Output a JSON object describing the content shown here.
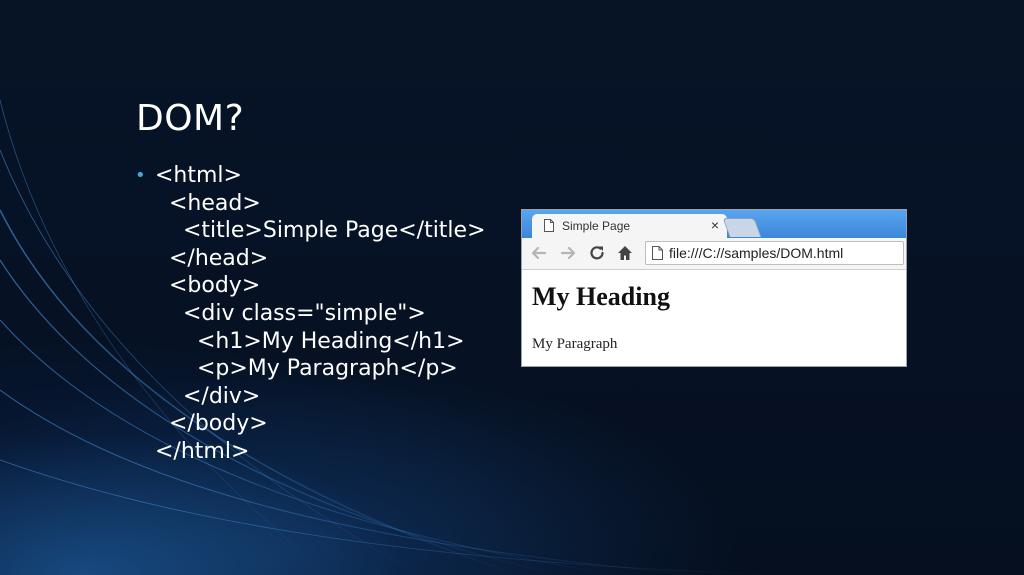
{
  "slide": {
    "title": "DOM?",
    "code_lines": [
      "<html>",
      "  <head>",
      "    <title>Simple Page</title>",
      "  </head>",
      "  <body>",
      "    <div class=\"simple\">",
      "      <h1>My Heading</h1>",
      "      <p>My Paragraph</p>",
      "    </div>",
      "  </body>",
      "</html>"
    ]
  },
  "browser": {
    "tab_title": "Simple Page",
    "tab_close": "×",
    "url": "file:///C://samples/DOM.html",
    "page": {
      "heading": "My Heading",
      "paragraph": "My Paragraph"
    },
    "icons": {
      "back": "back-arrow-icon",
      "forward": "forward-arrow-icon",
      "reload": "reload-icon",
      "home": "home-icon",
      "page": "page-icon"
    }
  },
  "colors": {
    "bullet": "#4aa3df",
    "tabbar": "#3b86d8",
    "slide_bg": "#061225"
  }
}
